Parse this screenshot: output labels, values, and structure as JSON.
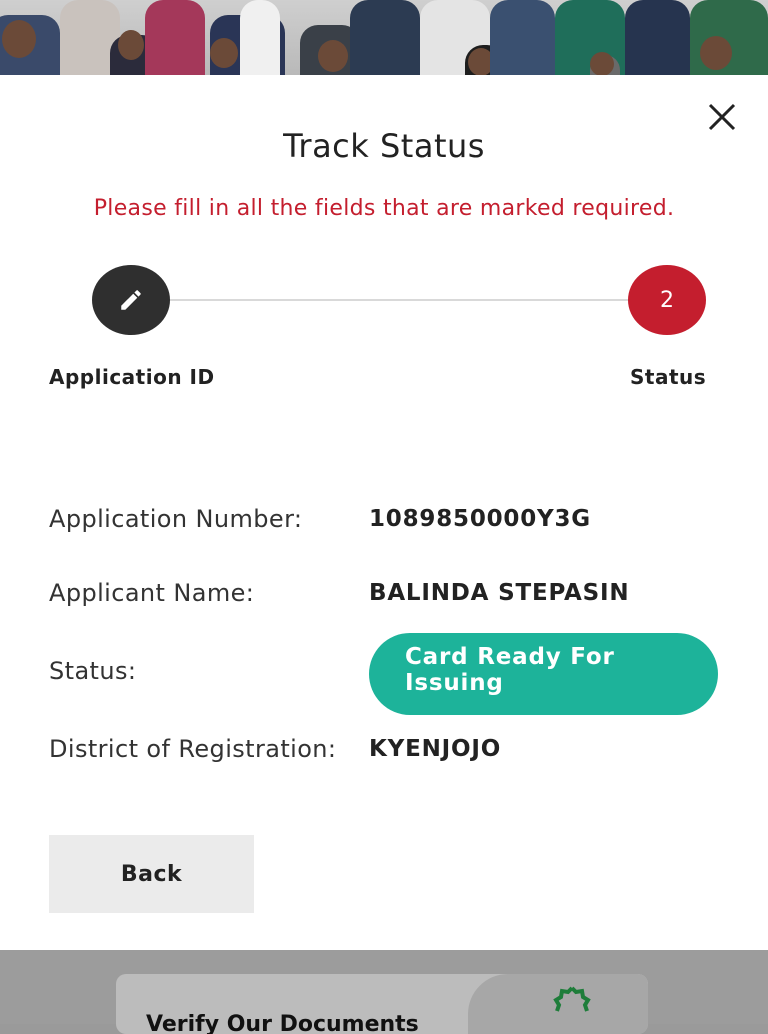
{
  "modal": {
    "title": "Track Status",
    "error_message": "Please fill in all the fields that are marked required.",
    "close_icon": "close-icon"
  },
  "stepper": {
    "steps": [
      {
        "label": "Application ID",
        "icon": "pencil-icon",
        "state": "completed"
      },
      {
        "label": "Status",
        "number": "2",
        "state": "active"
      }
    ],
    "colors": {
      "completed": "#2f2f2f",
      "active": "#c41e2e"
    }
  },
  "details": {
    "application_number": {
      "label": "Application Number:",
      "value": "1089850000Y3G"
    },
    "applicant_name": {
      "label": "Applicant Name:",
      "value": "BALINDA STEPASIN"
    },
    "status": {
      "label": "Status:",
      "value_line1": "Card Ready For",
      "value_line2": "Issuing",
      "color": "#1db39a"
    },
    "district": {
      "label": "District of Registration:",
      "value": "KYENJOJO"
    }
  },
  "actions": {
    "back_label": "Back"
  },
  "footer": {
    "verify_text": "Verify Our Documents",
    "icon": "verified-badge-icon",
    "icon_color": "#1e7d3a"
  }
}
